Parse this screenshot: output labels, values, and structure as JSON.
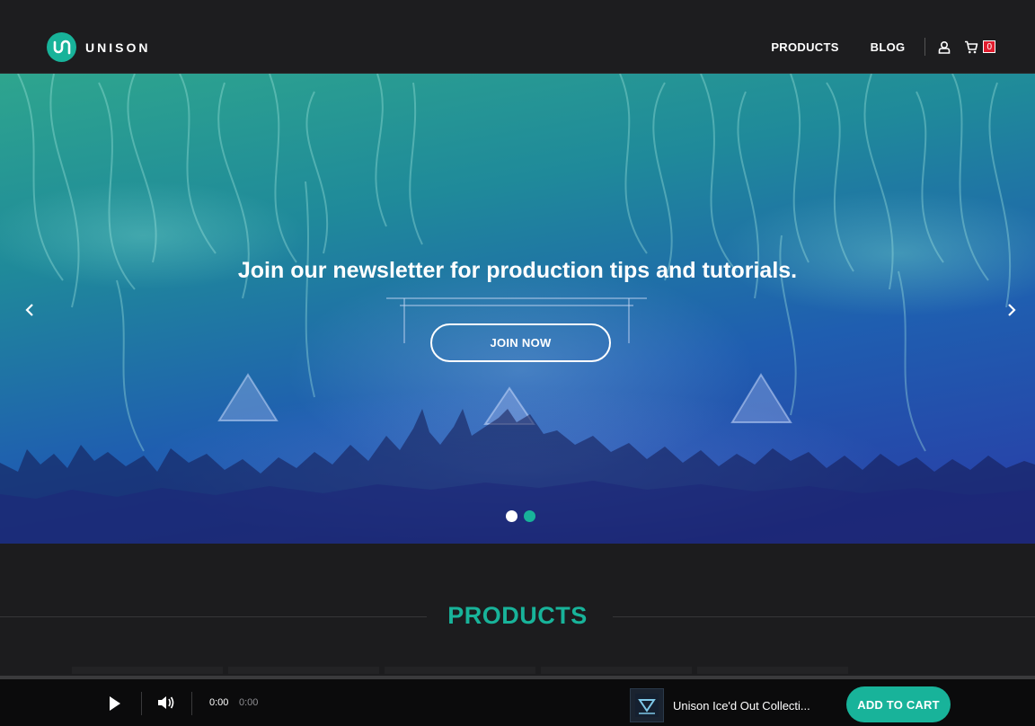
{
  "brand": {
    "name": "UNISON",
    "accent": "#18b39a"
  },
  "nav": {
    "links": [
      "PRODUCTS",
      "BLOG"
    ],
    "cart_count": "0",
    "account_icon": "user-icon",
    "cart_icon": "cart-icon"
  },
  "hero": {
    "title": "Join our newsletter for production tips and tutorials.",
    "cta": "JOIN NOW",
    "prev_icon": "chevron-left-icon",
    "next_icon": "chevron-right-icon",
    "slide_count": 2,
    "active_slide": 1
  },
  "products": {
    "heading": "PRODUCTS"
  },
  "player": {
    "current_time": "0:00",
    "total_time": "0:00",
    "track_title": "Unison Ice'd Out Collecti...",
    "add_to_cart": "ADD TO CART",
    "play_icon": "play-icon",
    "volume_icon": "volume-icon"
  },
  "colors": {
    "header_bg": "#1d1d1f",
    "page_bg": "#1c1c1e",
    "badge": "#e11d2e",
    "player_bg": "#0b0b0c"
  }
}
